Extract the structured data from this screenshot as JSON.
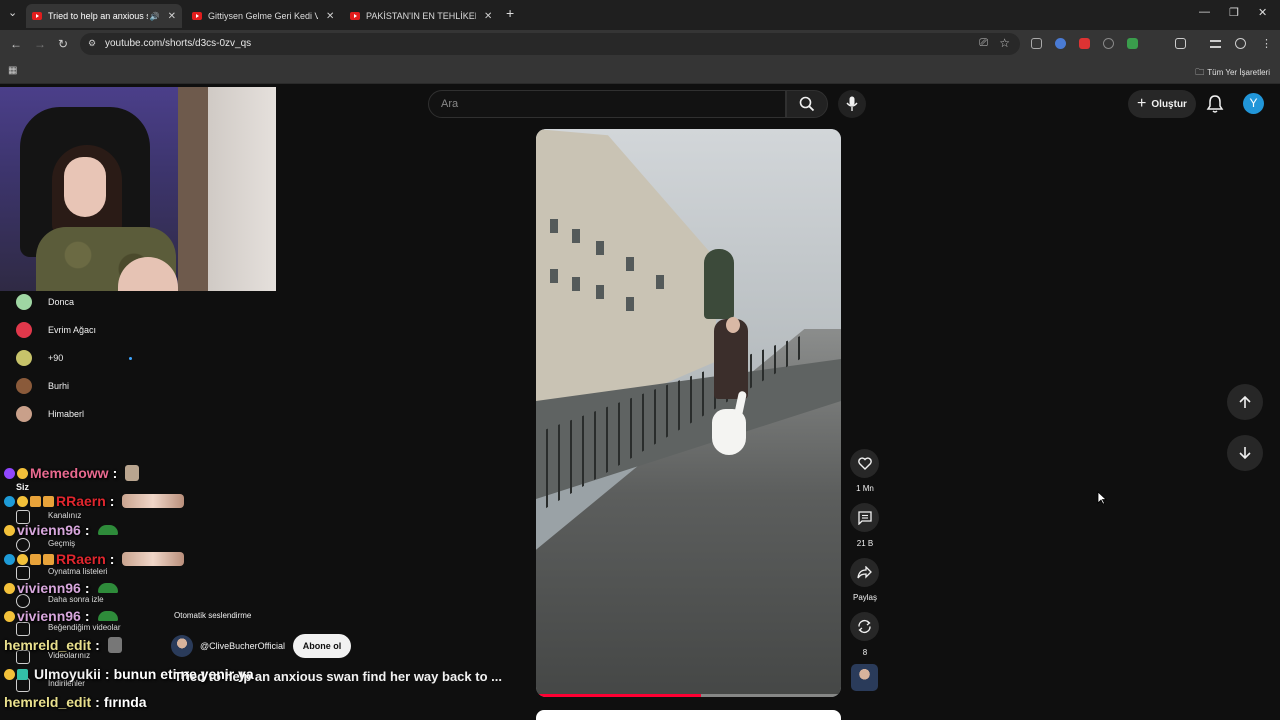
{
  "browser": {
    "tabs": [
      {
        "label": "Tried to help an anxious swan",
        "active": true
      },
      {
        "label": "Gittiysen Gelme Geri Kedi Versi",
        "active": false
      },
      {
        "label": "PAKİSTAN'IN EN TEHLİKELİ MA",
        "active": false
      }
    ],
    "new_tab_label": "+",
    "url": "youtube.com/shorts/d3cs-0zv_qs",
    "bookmarks_all_label": "Tüm Yer İşaretleri"
  },
  "youtube": {
    "search_placeholder": "Ara",
    "create_label": "Oluştur",
    "avatar_letter": "Y",
    "accent_color": "#ff0033"
  },
  "sidebar": {
    "subscriptions": [
      {
        "name": "Donca",
        "color": "#9fd6a3"
      },
      {
        "name": "Evrim Ağacı",
        "color": "#e0384b"
      },
      {
        "name": "+90",
        "color": "#c7c36a"
      },
      {
        "name": "Burhi",
        "color": "#8a5a3a"
      },
      {
        "name": "Himaberl",
        "color": "#c9a08a"
      }
    ],
    "section_you": "Siz",
    "nav": [
      {
        "label": "Kanalınız",
        "icon": "person-icon"
      },
      {
        "label": "Geçmiş",
        "icon": "history-icon"
      },
      {
        "label": "Oynatma listeleri",
        "icon": "playlist-icon"
      },
      {
        "label": "Daha sonra izle",
        "icon": "clock-icon"
      },
      {
        "label": "Beğendiğim videolar",
        "icon": "thumbs-up-icon"
      },
      {
        "label": "Videolarınız",
        "icon": "video-icon"
      },
      {
        "label": "İndirilenler",
        "icon": "download-icon"
      }
    ]
  },
  "chat": [
    {
      "user": "Memedoww",
      "color": "#e8698f",
      "sep": ":",
      "msg": ""
    },
    {
      "user": "RRaern",
      "color": "#e0262e",
      "sep": ":",
      "msg": ""
    },
    {
      "user": "vivienn96",
      "color": "#d7a6dc",
      "sep": ":",
      "msg": ""
    },
    {
      "user": "RRaern",
      "color": "#e0262e",
      "sep": ":",
      "msg": ""
    },
    {
      "user": "vivienn96",
      "color": "#d7a6dc",
      "sep": ":",
      "msg": ""
    },
    {
      "user": "vivienn96",
      "color": "#d7a6dc",
      "sep": ":",
      "msg": ""
    },
    {
      "user": "hemreld_edit",
      "color": "#e9e08d",
      "sep": ":",
      "msg": ""
    },
    {
      "user": "Ulmoyukii",
      "color": "#f1f1f1",
      "sep": ":",
      "msg": "bunun eti ne yenir ya"
    },
    {
      "user": "hemreld_edit",
      "color": "#e9e08d",
      "sep": ":",
      "msg": "fırında"
    }
  ],
  "video": {
    "autoplay_label": "Otomatik seslendirme",
    "channel": "@CliveBucherOfficial",
    "subscribe_label": "Abone ol",
    "title": "Tried to help an anxious swan find her way back to ...",
    "progress": 0.54
  },
  "actions": {
    "like_count": "1 Mn",
    "comment_count": "21 B",
    "share_label": "Paylaş",
    "remix_count": "8"
  }
}
